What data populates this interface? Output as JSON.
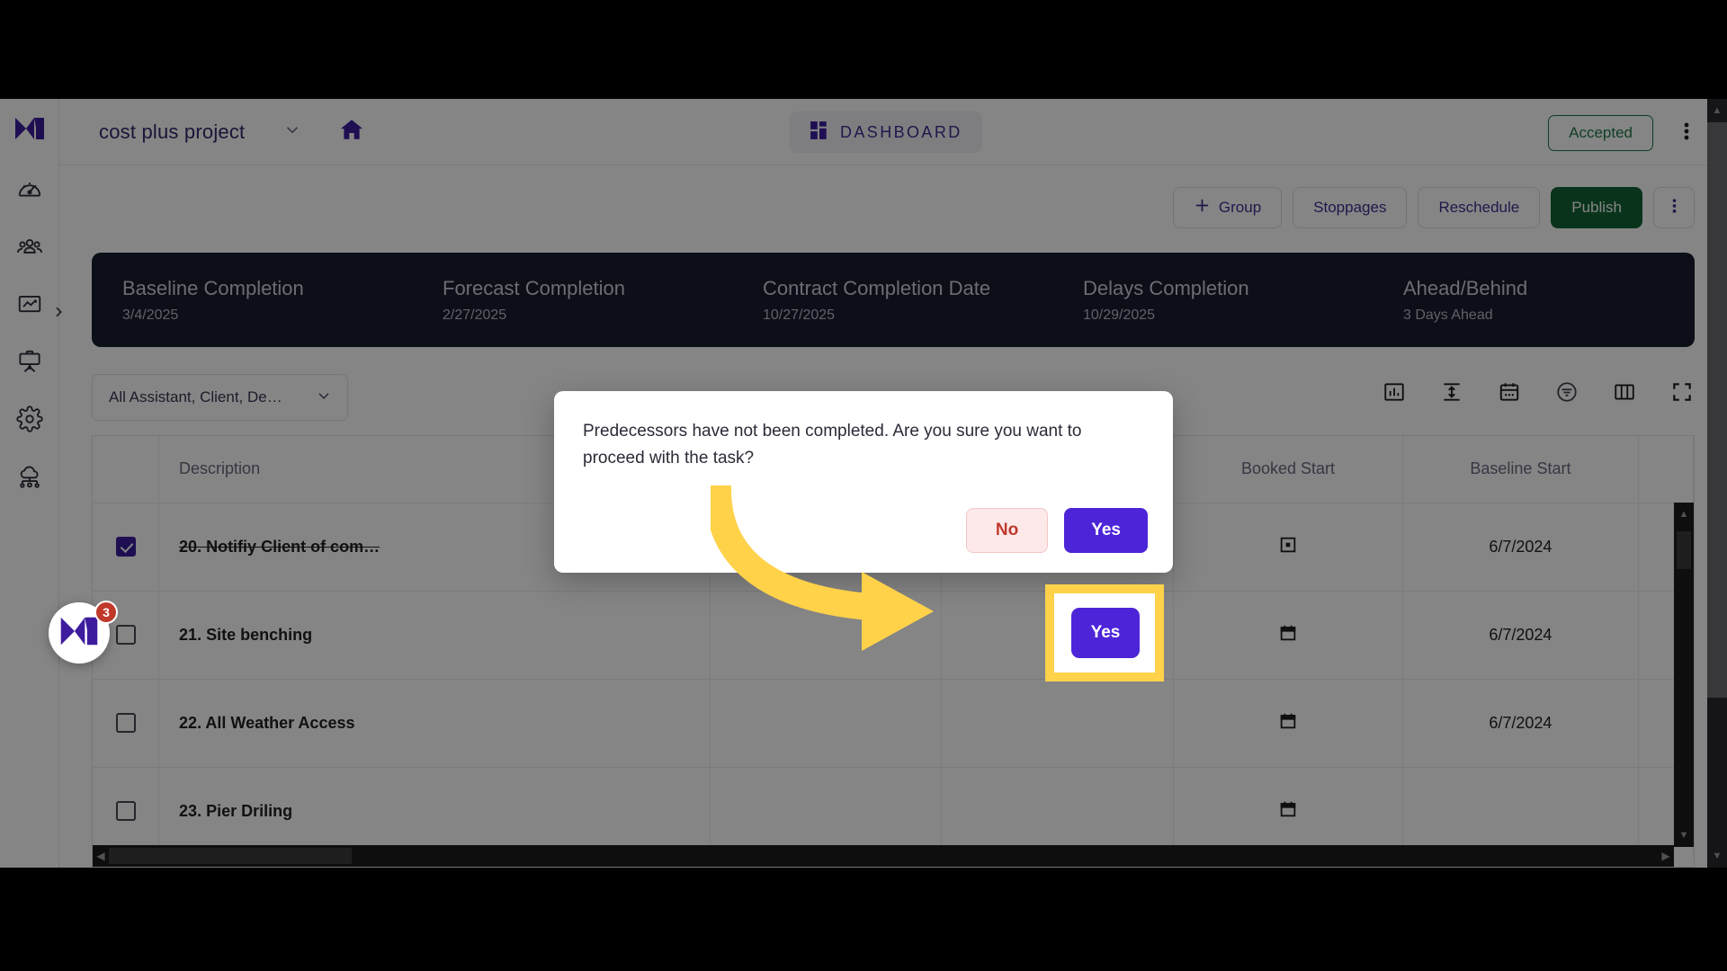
{
  "theme": {
    "brand_purple": "#3d2f91",
    "accent_purple": "#4d25d8",
    "green": "#136434",
    "green_outline": "#1e7a45",
    "dark_navy": "#181b2e",
    "highlight_yellow": "#ffd24a",
    "danger_red": "#c0392b"
  },
  "sidebar": {
    "logo_name": "mastt-logo",
    "items": [
      {
        "name": "dashboard-gauge",
        "icon": "gauge-icon"
      },
      {
        "name": "team",
        "icon": "people-icon"
      },
      {
        "name": "reports",
        "icon": "chart-icon"
      },
      {
        "name": "presentation",
        "icon": "presentation-board-icon"
      },
      {
        "name": "settings",
        "icon": "gear-icon"
      },
      {
        "name": "integrations",
        "icon": "cloud-network-icon"
      }
    ],
    "expand_icon": "chevron-right-icon"
  },
  "chat": {
    "badge_count": "3",
    "icon": "mastt-logo-icon"
  },
  "topbar": {
    "project_name": "cost plus project",
    "project_chevron_icon": "chevron-down-icon",
    "home_icon": "home-icon",
    "dashboard_label": "DASHBOARD",
    "dashboard_icon": "grid-blocks-icon",
    "status_label": "Accepted",
    "kebab_icon": "more-vertical-icon"
  },
  "action_bar": {
    "group_label": "Group",
    "group_icon": "plus-icon",
    "stoppages_label": "Stoppages",
    "reschedule_label": "Reschedule",
    "publish_label": "Publish",
    "kebab_icon": "more-vertical-icon"
  },
  "kpis": [
    {
      "label": "Baseline Completion",
      "value": "3/4/2025"
    },
    {
      "label": "Forecast Completion",
      "value": "2/27/2025"
    },
    {
      "label": "Contract Completion Date",
      "value": "10/27/2025"
    },
    {
      "label": "Delays Completion",
      "value": "10/29/2025"
    },
    {
      "label": "Ahead/Behind",
      "value": "3 Days Ahead"
    }
  ],
  "filter": {
    "selected": "All Assistant, Client, De…",
    "chevron_icon": "chevron-down-icon"
  },
  "table_tools": [
    {
      "name": "bar-chart-icon"
    },
    {
      "name": "row-height-icon"
    },
    {
      "name": "calendar-icon"
    },
    {
      "name": "filter-circle-icon"
    },
    {
      "name": "columns-icon"
    },
    {
      "name": "fullscreen-icon"
    }
  ],
  "table": {
    "columns": [
      "",
      "Description",
      "",
      "",
      "Booked Start",
      "Baseline Start",
      ""
    ],
    "rows": [
      {
        "checked": true,
        "completed": true,
        "description": "20. Notifiy Client of com…",
        "booked_start_icon": "calendar-filled-icon",
        "baseline_start": "6/7/2024"
      },
      {
        "checked": false,
        "completed": false,
        "description": "21. Site benching",
        "booked_start_icon": "calendar-icon",
        "baseline_start": "6/7/2024"
      },
      {
        "checked": false,
        "completed": false,
        "description": "22. All Weather Access",
        "booked_start_icon": "calendar-icon",
        "baseline_start": "6/7/2024"
      },
      {
        "checked": false,
        "completed": false,
        "description": "23. Pier Driling",
        "booked_start_icon": "calendar-icon",
        "baseline_start": ""
      }
    ]
  },
  "modal": {
    "message": "Predecessors have not been completed. Are you sure you want to proceed with the task?",
    "no_label": "No",
    "yes_label": "Yes"
  },
  "annotation": {
    "arrow": "curved-arrow-pointing-right",
    "highlight_target": "yes-button"
  }
}
